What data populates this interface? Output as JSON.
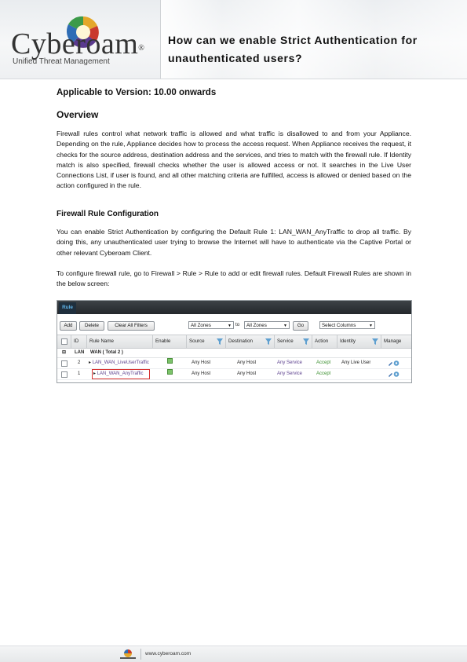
{
  "header": {
    "logo_word": "Cyberoam",
    "logo_reg": "®",
    "logo_tagline": "Unified Threat Management",
    "title": "How can we enable Strict Authentication for unauthenticated users?"
  },
  "doc": {
    "version_line": "Applicable to Version: 10.00 onwards",
    "overview_heading": "Overview",
    "overview_text": "Firewall rules control what network traffic is allowed and what traffic is disallowed to and from your Appliance. Depending on the rule, Appliance decides how to process the access request. When Appliance receives the request, it checks for the source address, destination address and the services, and tries to match with the firewall rule. If Identity match is also specified, firewall checks whether the user is allowed access or not. It searches in the Live User Connections List, if user is found, and all other matching criteria are fulfilled, access is allowed or denied based on the action configured in the rule.",
    "config_heading": "Firewall Rule Configuration",
    "config_text_1": "You can enable Strict Authentication by configuring the Default Rule 1: LAN_WAN_AnyTraffic to drop all traffic. By doing this, any unauthenticated user trying to browse the Internet will have to authenticate via the Captive Portal or other relevant Cyberoam Client.",
    "config_text_2": "To configure firewall rule, go to Firewall > Rule > Rule to add or edit firewall rules. Default Firewall Rules are shown in the below screen:"
  },
  "screenshot": {
    "tab": "Rule",
    "buttons": {
      "add": "Add",
      "delete": "Delete",
      "clear": "Clear All Filters",
      "go": "Go"
    },
    "zone_from": "All Zones",
    "to_label": "to",
    "zone_to": "All Zones",
    "select_columns": "Select Columns",
    "columns": [
      "ID",
      "Rule Name",
      "Enable",
      "Source",
      "Destination",
      "Service",
      "Action",
      "Identity",
      "Manage"
    ],
    "group": {
      "zone": "LAN",
      "label": "WAN ( Total 2 )"
    },
    "rows": [
      {
        "id": "2",
        "name": "LAN_WAN_LiveUserTraffic",
        "source": "Any Host",
        "destination": "Any Host",
        "service": "Any Service",
        "action": "Accept",
        "identity": "Any Live User"
      },
      {
        "id": "1",
        "name": "LAN_WAN_AnyTraffic",
        "source": "Any Host",
        "destination": "Any Host",
        "service": "Any Service",
        "action": "Accept",
        "identity": ""
      }
    ]
  },
  "footer": {
    "url": "www.cyberoam.com"
  },
  "colors": {
    "tab_text": "#5fb2e6",
    "accept": "#3a8f2e",
    "highlight": "#d63030"
  }
}
